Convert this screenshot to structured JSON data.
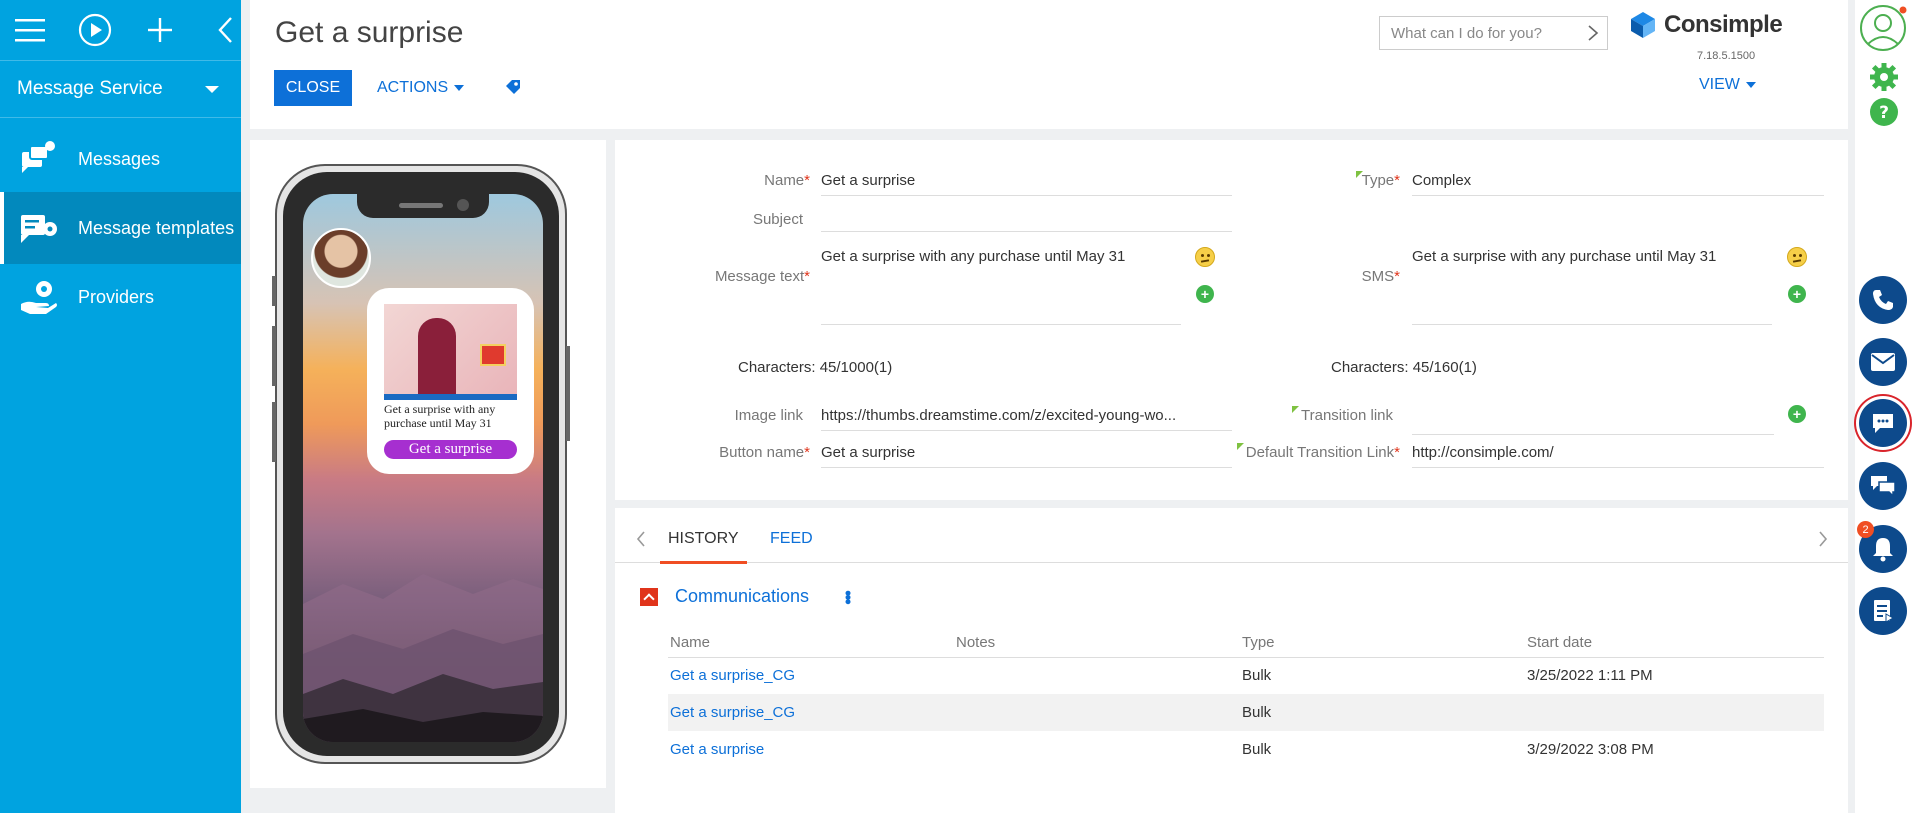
{
  "sidebar": {
    "section": "Message Service",
    "items": [
      {
        "label": "Messages",
        "icon": "messages-icon"
      },
      {
        "label": "Message templates",
        "icon": "message-templates-icon"
      },
      {
        "label": "Providers",
        "icon": "providers-icon"
      }
    ]
  },
  "header": {
    "title": "Get a surprise",
    "close_label": "CLOSE",
    "actions_label": "ACTIONS",
    "search_placeholder": "What can I do for you?",
    "logo": "Consimple",
    "version": "7.18.5.1500",
    "view_label": "VIEW"
  },
  "preview": {
    "text": "Get a surprise with any purchase until May 31",
    "button": "Get a surprise"
  },
  "form": {
    "name_label": "Name",
    "name_value": "Get a surprise",
    "type_label": "Type",
    "type_value": "Complex",
    "subject_label": "Subject",
    "subject_value": "",
    "message_label": "Message text",
    "message_value": "Get a surprise with any purchase until May 31",
    "sms_label": "SMS",
    "sms_value": "Get a surprise with any purchase until May 31",
    "chars_message": "Characters: 45/1000(1)",
    "chars_sms": "Characters: 45/160(1)",
    "image_link_label": "Image link",
    "image_link_value": "https://thumbs.dreamstime.com/z/excited-young-wo...",
    "transition_label": "Transition link",
    "transition_value": "",
    "button_name_label": "Button name",
    "button_name_value": "Get a surprise",
    "default_transition_label": "Default Transition Link",
    "default_transition_value": "http://consimple.com/",
    "required_mark": "*"
  },
  "history": {
    "tabs": [
      "HISTORY",
      "FEED"
    ],
    "group_title": "Communications",
    "columns": [
      "Name",
      "Notes",
      "Type",
      "Start date"
    ],
    "rows": [
      {
        "name": "Get a surprise_CG",
        "notes": "",
        "type": "Bulk",
        "start": "3/25/2022 1:11 PM"
      },
      {
        "name": "Get a surprise_CG",
        "notes": "",
        "type": "Bulk",
        "start": ""
      },
      {
        "name": "Get a surprise",
        "notes": "",
        "type": "Bulk",
        "start": "3/29/2022 3:08 PM"
      }
    ]
  },
  "rightbar": {
    "notifications_count": "2"
  },
  "colors": {
    "sidebar": "#00a3e0",
    "accent": "#0d70d8",
    "required": "#e0341b"
  }
}
